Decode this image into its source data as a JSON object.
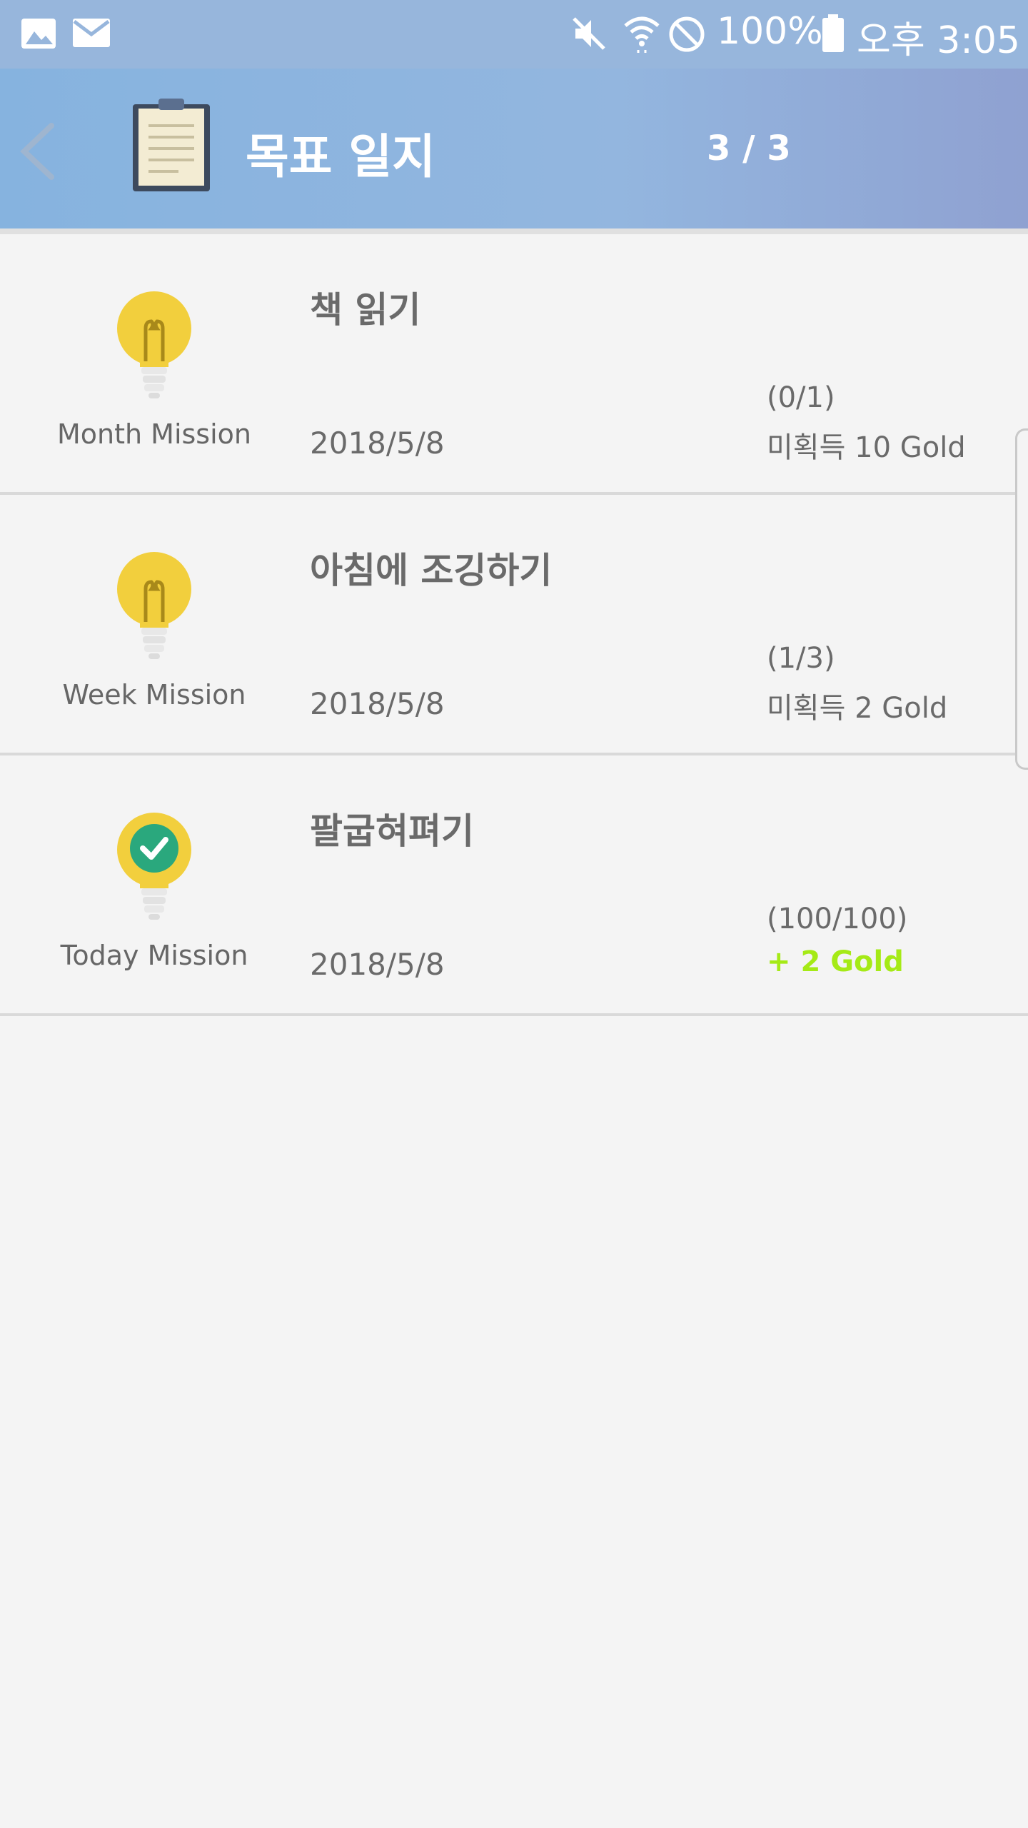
{
  "status_bar": {
    "battery": "100%",
    "time": "오후 3:05",
    "icons": [
      "image-icon",
      "mail-icon",
      "mute-icon",
      "wifi-icon",
      "block-icon",
      "battery-icon"
    ]
  },
  "header": {
    "title": "목표 일지",
    "page_indicator": "3 / 3",
    "back_icon": "chevron-left-icon",
    "title_icon": "clipboard-icon"
  },
  "missions": [
    {
      "title": "책  읽기",
      "type": "Month Mission",
      "date": "2018/5/8",
      "progress": "(0/1)",
      "reward": "미획득 10 Gold",
      "completed": false
    },
    {
      "title": "아침에  조깅하기",
      "type": "Week Mission",
      "date": "2018/5/8",
      "progress": "(1/3)",
      "reward": "미획득 2 Gold",
      "completed": false
    },
    {
      "title": "팔굽혀펴기",
      "type": "Today Mission",
      "date": "2018/5/8",
      "progress": "(100/100)",
      "reward": "+ 2 Gold",
      "completed": true
    }
  ],
  "colors": {
    "status_bar": "#97b6dc",
    "header_start": "#86b3df",
    "header_end": "#8fa1d1",
    "bulb": "#f2cf3d",
    "earned_reward": "#a5ea16",
    "check": "#2aa87d"
  }
}
